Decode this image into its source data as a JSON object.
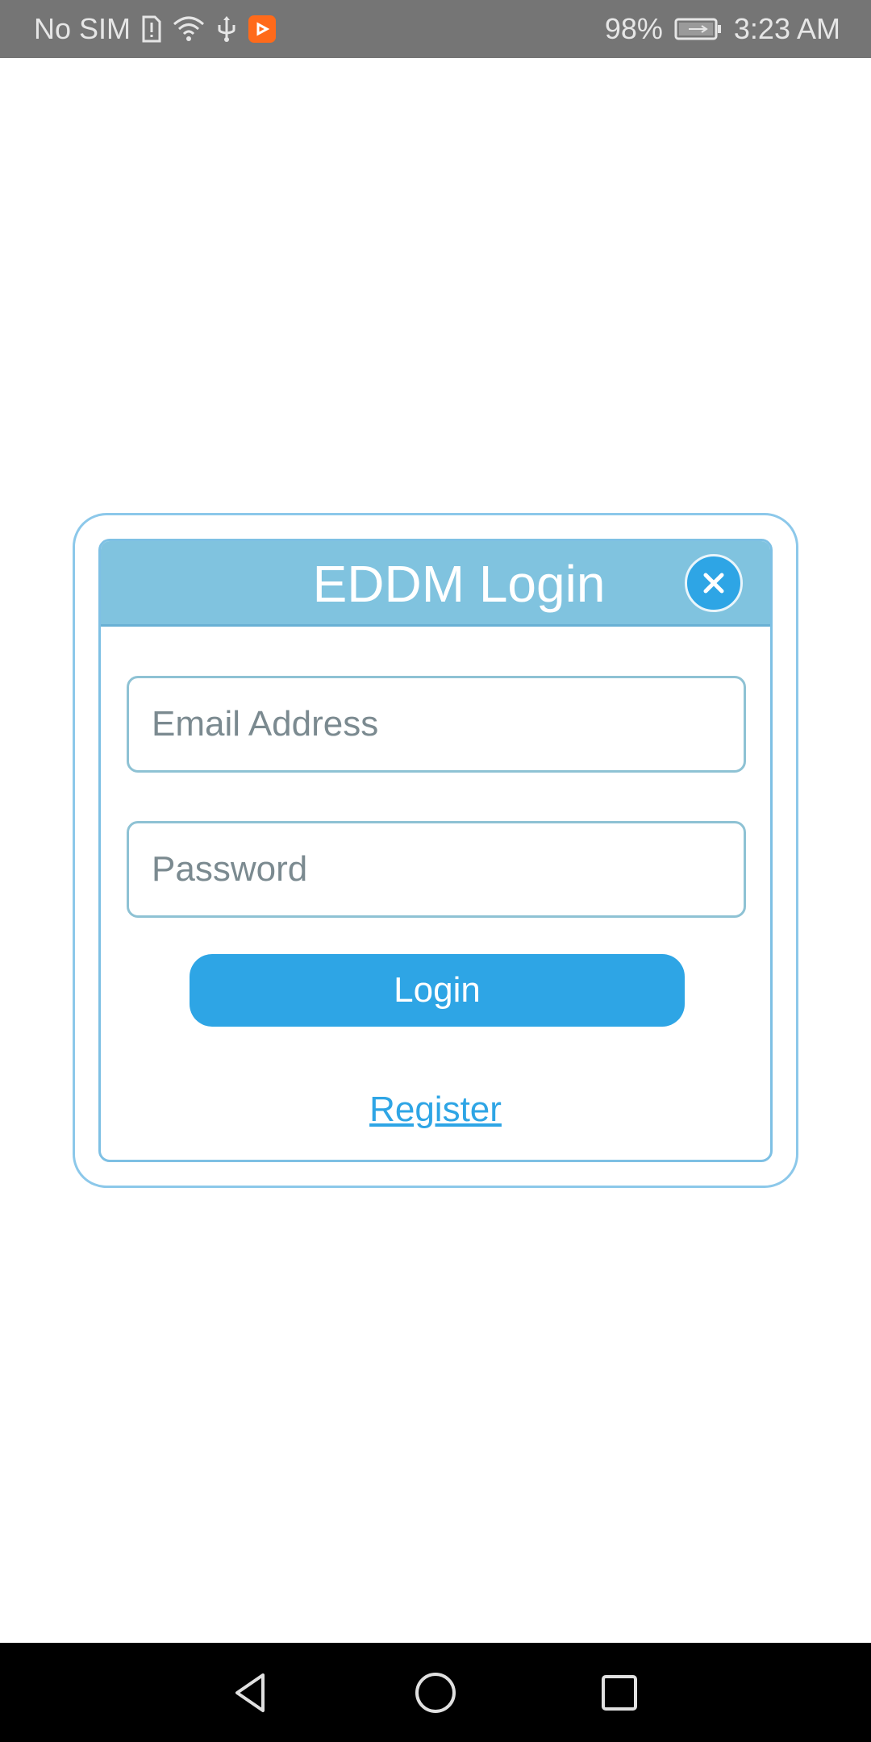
{
  "status_bar": {
    "carrier": "No SIM",
    "battery": "98%",
    "time": "3:23 AM",
    "icons": [
      "sim-alert-icon",
      "wifi-icon",
      "usb-icon",
      "app-notification-icon",
      "battery-charging-icon"
    ]
  },
  "dialog": {
    "title": "EDDM Login",
    "close_icon": "close-icon",
    "email": {
      "placeholder": "Email Address",
      "value": ""
    },
    "password": {
      "placeholder": "Password",
      "value": ""
    },
    "login_label": "Login",
    "register_label": "Register"
  },
  "nav_bar": {
    "buttons": [
      "back-icon",
      "home-icon",
      "recents-icon"
    ]
  },
  "colors": {
    "accent": "#2ea5e5",
    "header": "#80c3df",
    "frame": "#8cc8ea",
    "status_bar": "#757575",
    "nav_bar": "#000000"
  }
}
